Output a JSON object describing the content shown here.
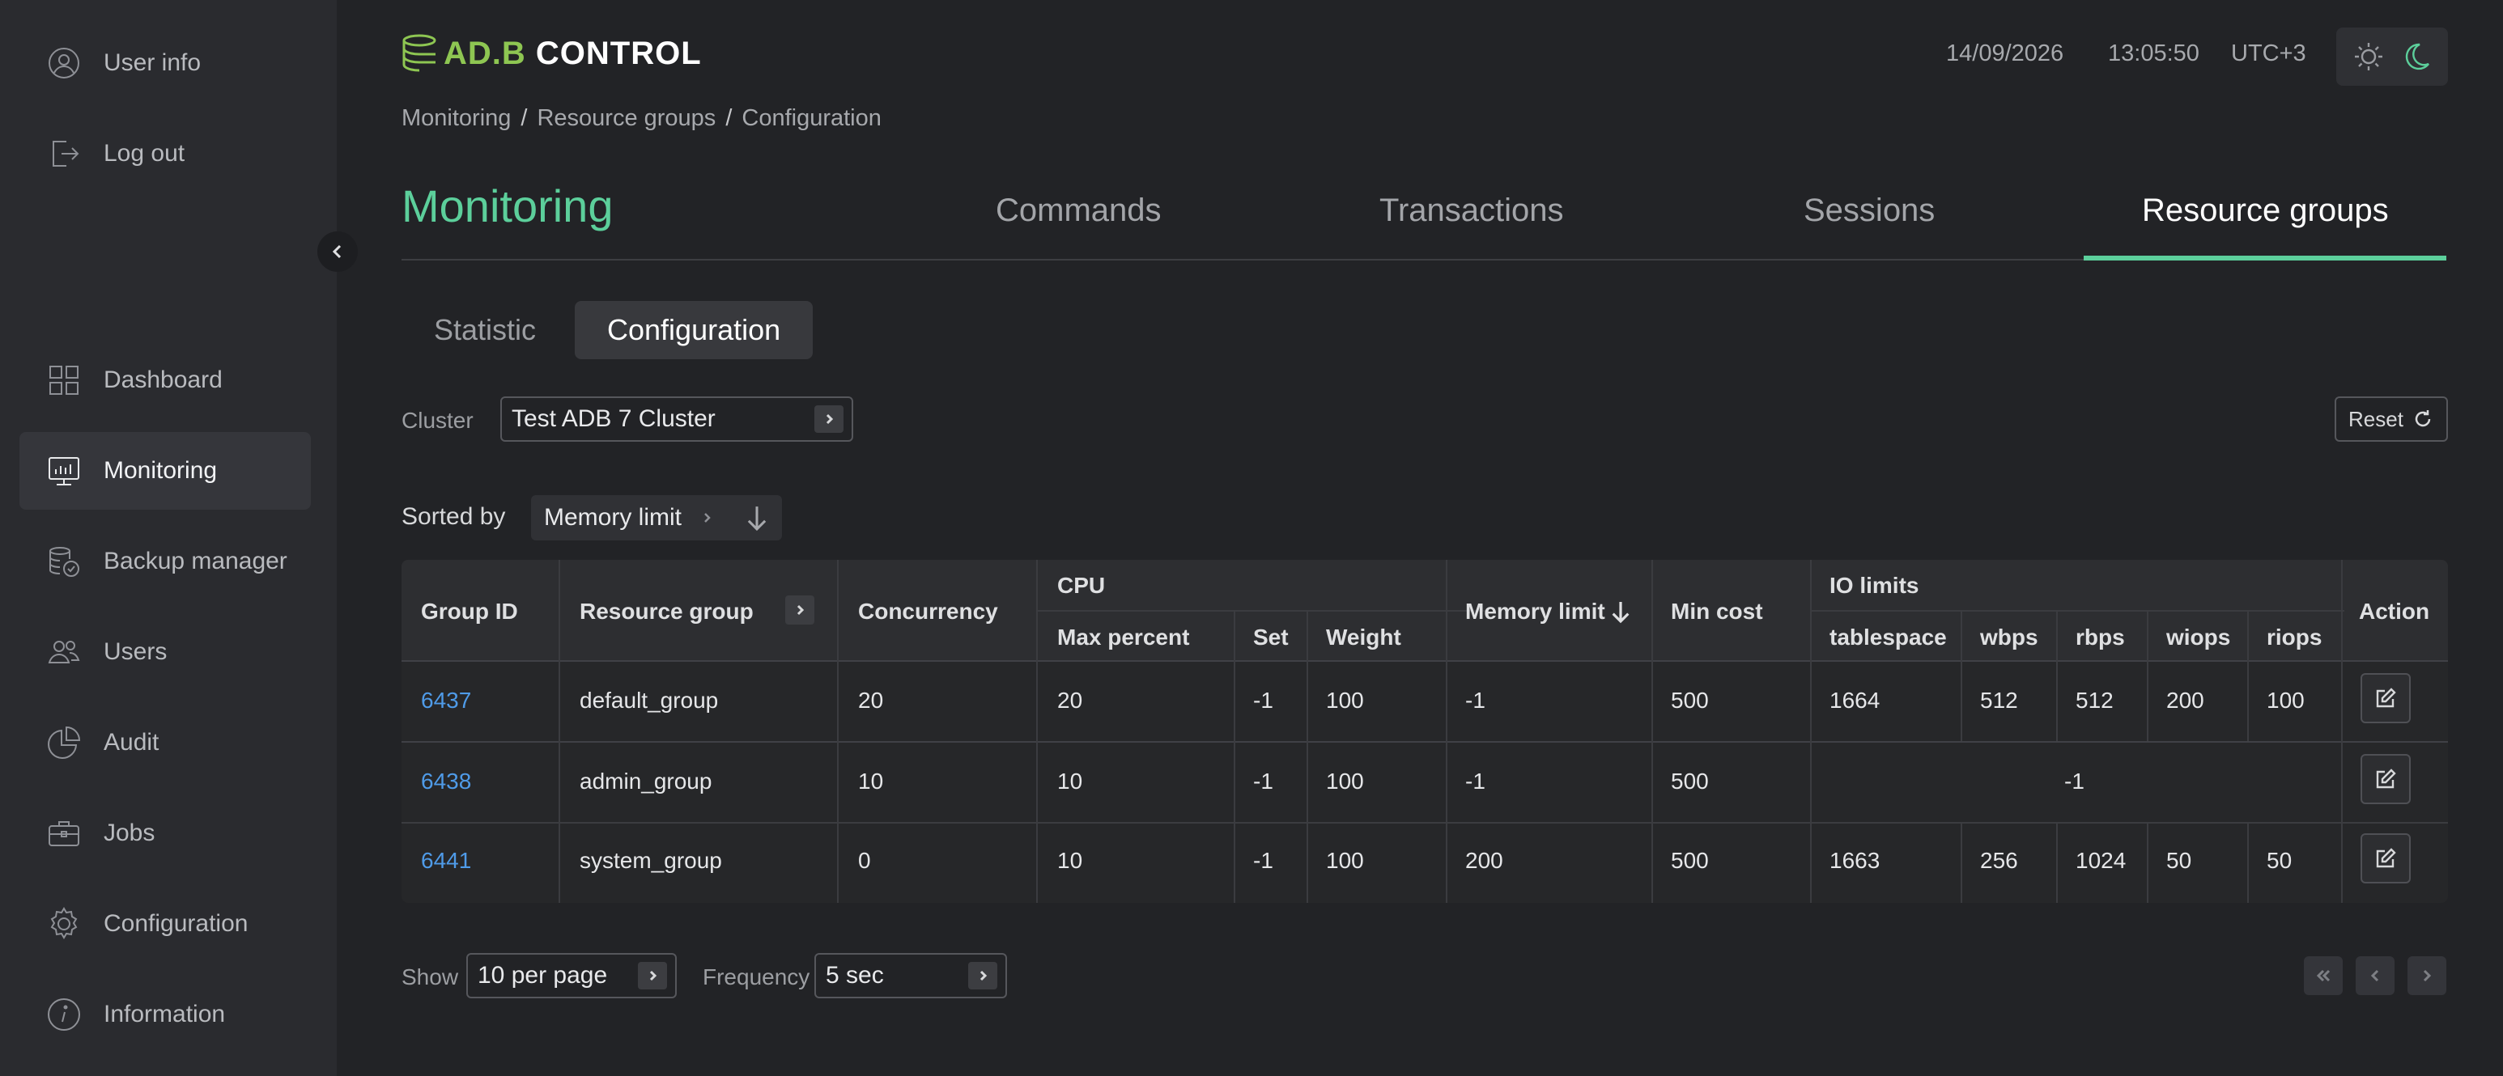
{
  "sidebar": {
    "user_info": "User info",
    "log_out": "Log out",
    "items": [
      {
        "label": "Dashboard",
        "icon": "dashboard-icon"
      },
      {
        "label": "Monitoring",
        "icon": "monitoring-icon",
        "active": true
      },
      {
        "label": "Backup manager",
        "icon": "backup-icon"
      },
      {
        "label": "Users",
        "icon": "users-icon"
      },
      {
        "label": "Audit",
        "icon": "audit-icon"
      },
      {
        "label": "Jobs",
        "icon": "jobs-icon"
      },
      {
        "label": "Configuration",
        "icon": "gear-icon"
      },
      {
        "label": "Information",
        "icon": "info-icon"
      }
    ]
  },
  "header": {
    "logo_prefix": "AD.B",
    "logo_suffix": " CONTROL",
    "date": "14/09/2026",
    "time": "13:05:50",
    "timezone": "UTC+3"
  },
  "breadcrumb": [
    "Monitoring",
    "Resource groups",
    "Configuration"
  ],
  "page": {
    "title": "Monitoring",
    "tabs": [
      "Commands",
      "Transactions",
      "Sessions",
      "Resource groups"
    ],
    "active_tab": "Resource groups",
    "subtabs": [
      "Statistic",
      "Configuration"
    ],
    "active_subtab": "Configuration"
  },
  "filters": {
    "cluster_label": "Cluster",
    "cluster_value": "Test ADB 7 Cluster",
    "reset_label": "Reset",
    "sorted_by_label": "Sorted by",
    "sorted_by_value": "Memory limit"
  },
  "table": {
    "headers": {
      "group_id": "Group ID",
      "resource_group": "Resource group",
      "concurrency": "Concurrency",
      "cpu": "CPU",
      "max_percent": "Max percent",
      "set": "Set",
      "weight": "Weight",
      "memory_limit": "Memory limit",
      "min_cost": "Min cost",
      "io_limits": "IO limits",
      "tablespace": "tablespace",
      "wbps": "wbps",
      "rbps": "rbps",
      "wiops": "wiops",
      "riops": "riops",
      "action": "Action"
    },
    "rows": [
      {
        "group_id": "6437",
        "resource_group": "default_group",
        "concurrency": "20",
        "max_percent": "20",
        "set": "-1",
        "weight": "100",
        "memory_limit": "-1",
        "min_cost": "500",
        "tablespace": "1664",
        "wbps": "512",
        "rbps": "512",
        "wiops": "200",
        "riops": "100"
      },
      {
        "group_id": "6438",
        "resource_group": "admin_group",
        "concurrency": "10",
        "max_percent": "10",
        "set": "-1",
        "weight": "100",
        "memory_limit": "-1",
        "min_cost": "500",
        "io_limits": "-1"
      },
      {
        "group_id": "6441",
        "resource_group": "system_group",
        "concurrency": "0",
        "max_percent": "10",
        "set": "-1",
        "weight": "100",
        "memory_limit": "200",
        "min_cost": "500",
        "tablespace": "1663",
        "wbps": "256",
        "rbps": "1024",
        "wiops": "50",
        "riops": "50"
      }
    ]
  },
  "footer": {
    "show_label": "Show",
    "show_value": "10 per page",
    "frequency_label": "Frequency",
    "frequency_value": "5 sec"
  },
  "colors": {
    "accent": "#5ccf9b",
    "link": "#4f9be8",
    "background": "#222326",
    "sidebar": "#2a2b2f"
  }
}
